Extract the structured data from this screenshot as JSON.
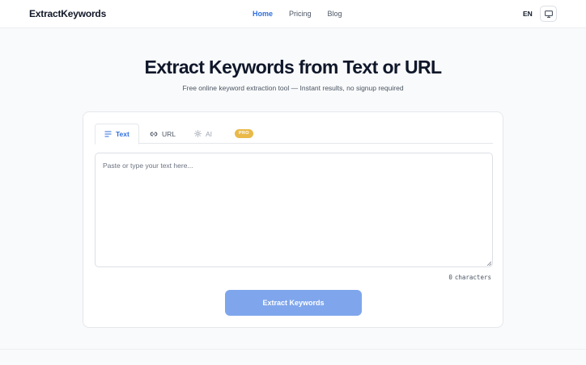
{
  "header": {
    "logo": "ExtractKeywords",
    "nav": [
      {
        "label": "Home",
        "active": true
      },
      {
        "label": "Pricing",
        "active": false
      },
      {
        "label": "Blog",
        "active": false
      }
    ],
    "language": "EN",
    "display_icon": "monitor-icon"
  },
  "hero": {
    "title": "Extract Keywords from Text or URL",
    "subtitle": "Free online keyword extraction tool — Instant results, no signup required"
  },
  "tabs": [
    {
      "label": "Text",
      "icon": "lines-icon",
      "active": true
    },
    {
      "label": "URL",
      "icon": "link-icon",
      "active": false
    },
    {
      "label": "AI",
      "icon": "sparkle-icon",
      "active": false,
      "badge": "PRO"
    }
  ],
  "input": {
    "placeholder": "Paste or type your text here...",
    "value": ""
  },
  "char_count": {
    "count": "0",
    "unit": "characters"
  },
  "extract_button": {
    "label": "Extract Keywords"
  },
  "colors": {
    "accent": "#2f6fde",
    "button": "#7fa6ec",
    "pro_badge": "#e9b949"
  }
}
